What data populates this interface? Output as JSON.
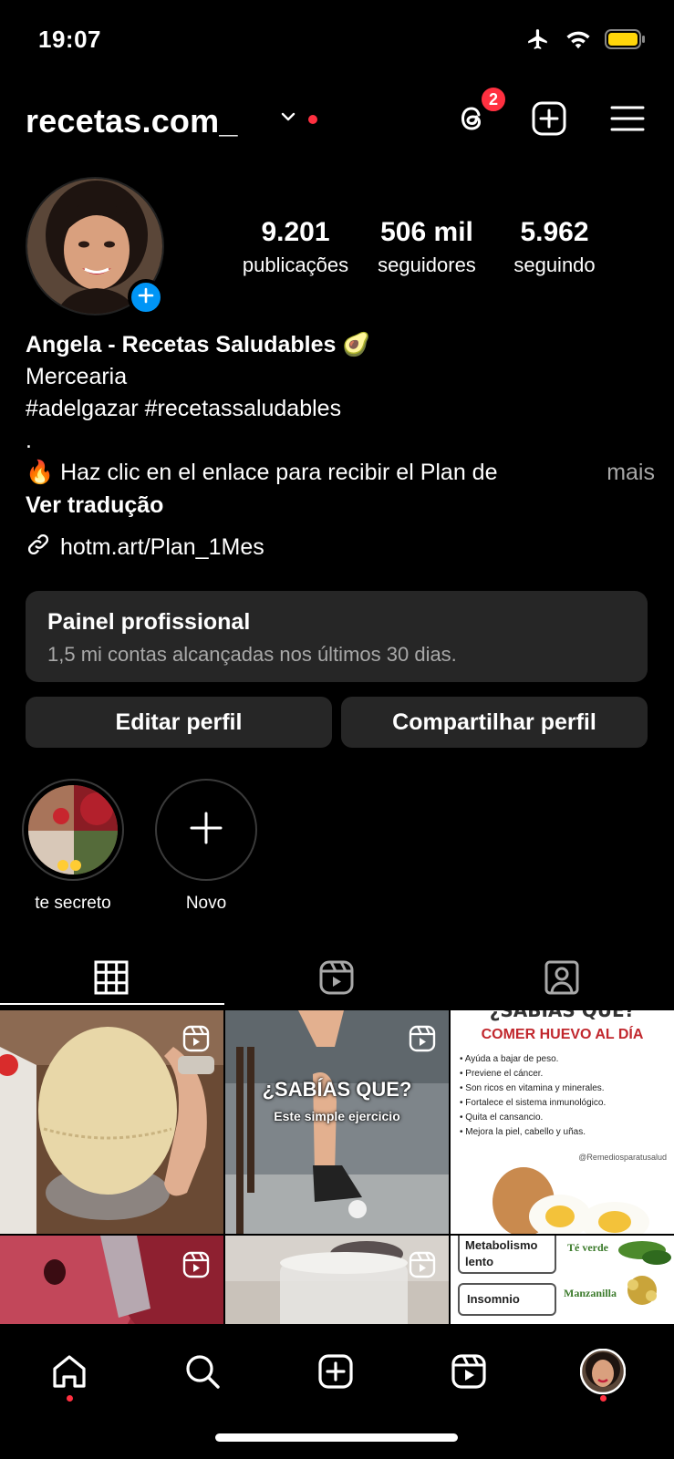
{
  "status_bar": {
    "time": "19:07"
  },
  "header": {
    "username": "recetas.com_",
    "threads_badge": "2"
  },
  "profile": {
    "stats": [
      {
        "value": "9.201",
        "label": "publicações"
      },
      {
        "value": "506 mil",
        "label": "seguidores"
      },
      {
        "value": "5.962",
        "label": "seguindo"
      }
    ],
    "name": "Angela - Recetas Saludables 🥑",
    "category": "Mercearia",
    "bio_line1": "#adelgazar #recetassaludables",
    "bio_line2": ".",
    "bio_line3": "🔥 Haz clic en el enlace para recibir el Plan de",
    "more": "mais",
    "translate": "Ver tradução",
    "link": "hotm.art/Plan_1Mes"
  },
  "pro_panel": {
    "title": "Painel profissional",
    "subtitle": "1,5 mi contas alcançadas nos últimos 30 dias."
  },
  "buttons": {
    "edit": "Editar perfil",
    "share": "Compartilhar perfil"
  },
  "highlights": [
    {
      "label": "te secreto"
    },
    {
      "label": "Novo"
    }
  ],
  "grid": {
    "post2_title": "¿SABÍAS QUE?",
    "post2_sub": "Este simple ejercicio",
    "post3_header": "¿SABÍAS QUE?",
    "post3_title": "COMER HUEVO AL DÍA",
    "post3_items": [
      "Ayúda a bajar de peso.",
      "Previene el cáncer.",
      "Son ricos en vitamina y minerales.",
      "Fortalece el sistema inmunológico.",
      "Quita el cansancio.",
      "Mejora la piel, cabello y uñas."
    ],
    "post3_handle": "@Remediosparatusalud",
    "post6_row1": "Metabolismo lento",
    "post6_row2": "Insomnio",
    "post6_label1": "Té verde",
    "post6_label2": "Manzanilla"
  }
}
